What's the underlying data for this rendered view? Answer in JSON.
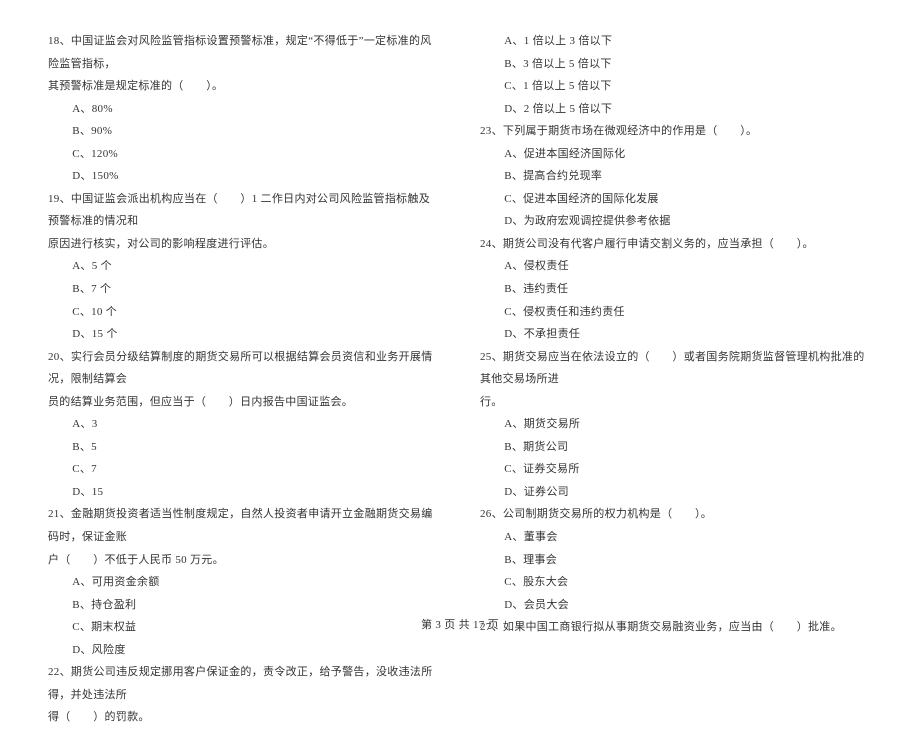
{
  "left": {
    "q18": {
      "text1": "18、中国证监会对风险监管指标设置预警标准，规定“不得低于”一定标准的风险监管指标，",
      "text2": "其预警标准是规定标准的（　　）。",
      "a": "A、80%",
      "b": "B、90%",
      "c": "C、120%",
      "d": "D、150%"
    },
    "q19": {
      "text1": "19、中国证监会派出机构应当在（　　）1 二作日内对公司风险监管指标触及预警标准的情况和",
      "text2": "原因进行核实，对公司的影响程度进行评估。",
      "a": "A、5 个",
      "b": "B、7 个",
      "c": "C、10 个",
      "d": "D、15 个"
    },
    "q20": {
      "text1": "20、实行会员分级结算制度的期货交易所可以根据结算会员资信和业务开展情况，限制结算会",
      "text2": "员的结算业务范围，但应当于（　　）日内报告中国证监会。",
      "a": "A、3",
      "b": "B、5",
      "c": "C、7",
      "d": "D、15"
    },
    "q21": {
      "text1": "21、金融期货投资者适当性制度规定，自然人投资者申请开立金融期货交易编码时，保证金账",
      "text2": "户（　　）不低于人民币 50 万元。",
      "a": "A、可用资金余额",
      "b": "B、持仓盈利",
      "c": "C、期末权益",
      "d": "D、风险度"
    },
    "q22": {
      "text1": "22、期货公司违反规定挪用客户保证金的，责令改正，给予警告，没收违法所得，并处违法所",
      "text2": "得（　　）的罚款。"
    }
  },
  "right": {
    "q22opts": {
      "a": "A、1 倍以上 3 倍以下",
      "b": "B、3 倍以上 5 倍以下",
      "c": "C、1 倍以上 5 倍以下",
      "d": "D、2 倍以上 5 倍以下"
    },
    "q23": {
      "text": "23、下列属于期货市场在微观经济中的作用是（　　）。",
      "a": "A、促进本国经济国际化",
      "b": "B、提高合约兑现率",
      "c": "C、促进本国经济的国际化发展",
      "d": "D、为政府宏观调控提供参考依据"
    },
    "q24": {
      "text": "24、期货公司没有代客户履行申请交割义务的，应当承担（　　）。",
      "a": "A、侵权责任",
      "b": "B、违约责任",
      "c": "C、侵权责任和违约责任",
      "d": "D、不承担责任"
    },
    "q25": {
      "text1": "25、期货交易应当在依法设立的（　　）或者国务院期货监督管理机构批准的其他交易场所进",
      "text2": "行。",
      "a": "A、期货交易所",
      "b": "B、期货公司",
      "c": "C、证券交易所",
      "d": "D、证券公司"
    },
    "q26": {
      "text": "26、公司制期货交易所的权力机构是（　　）。",
      "a": "A、董事会",
      "b": "B、理事会",
      "c": "C、股东大会",
      "d": "D、会员大会"
    },
    "q27": {
      "text": "27、如果中国工商银行拟从事期货交易融资业务，应当由（　　）批准。"
    }
  },
  "footer": "第 3 页 共 17 页"
}
